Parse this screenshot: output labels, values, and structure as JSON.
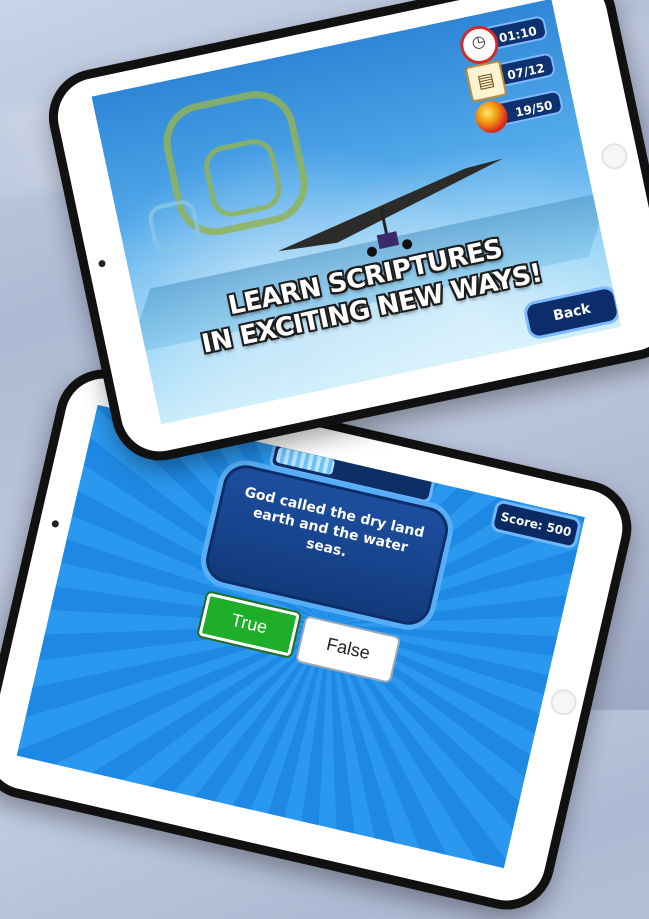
{
  "game_screen": {
    "hud": {
      "timer": "01:10",
      "chapters": "07/12",
      "balls": "19/50"
    },
    "headline": {
      "line1": "LEARN SCRIPTURES",
      "line2": "IN EXCITING NEW WAYS!"
    },
    "back_label": "Back"
  },
  "quiz_screen": {
    "score": "Score: 500",
    "progress": 0.4,
    "question": "God called the dry land earth and the water seas.",
    "answers": {
      "true_label": "True",
      "false_label": "False"
    }
  },
  "colors": {
    "true_button": "#1fae2a",
    "hud_background": "#0e3170",
    "quiz_background": "#2a98ef"
  }
}
